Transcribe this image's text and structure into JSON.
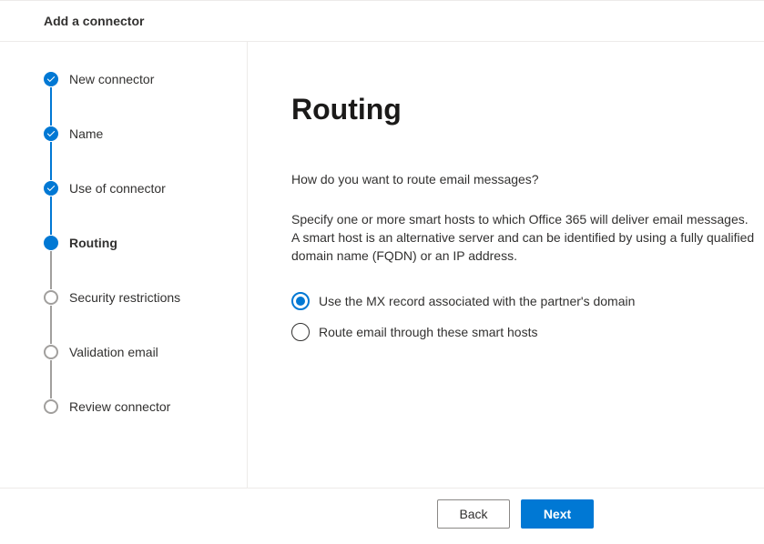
{
  "header": {
    "title": "Add a connector"
  },
  "sidebar": {
    "steps": [
      {
        "label": "New connector",
        "state": "completed"
      },
      {
        "label": "Name",
        "state": "completed"
      },
      {
        "label": "Use of connector",
        "state": "completed"
      },
      {
        "label": "Routing",
        "state": "current"
      },
      {
        "label": "Security restrictions",
        "state": "upcoming"
      },
      {
        "label": "Validation email",
        "state": "upcoming"
      },
      {
        "label": "Review connector",
        "state": "upcoming"
      }
    ]
  },
  "main": {
    "title": "Routing",
    "lead": "How do you want to route email messages?",
    "description": "Specify one or more smart hosts to which Office 365 will deliver email messages. A smart host is an alternative server and can be identified by using a fully qualified domain name (FQDN) or an IP address.",
    "options": [
      {
        "label": "Use the MX record associated with the partner's domain",
        "selected": true
      },
      {
        "label": "Route email through these smart hosts",
        "selected": false
      }
    ]
  },
  "footer": {
    "back": "Back",
    "next": "Next"
  }
}
